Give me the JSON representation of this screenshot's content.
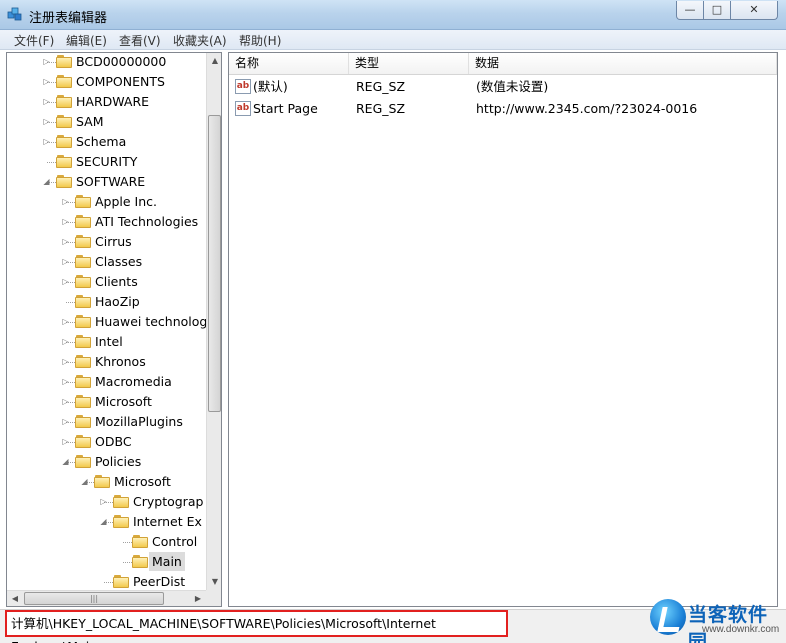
{
  "window": {
    "title": "注册表编辑器",
    "controls": {
      "minimize": "—",
      "maximize": "□",
      "close": "✕"
    }
  },
  "menu": [
    "文件(F)",
    "编辑(E)",
    "查看(V)",
    "收藏夹(A)",
    "帮助(H)"
  ],
  "tree": {
    "items": [
      {
        "label": "BCD00000000",
        "level": 0,
        "state": "collapsed"
      },
      {
        "label": "COMPONENTS",
        "level": 0,
        "state": "collapsed"
      },
      {
        "label": "HARDWARE",
        "level": 0,
        "state": "collapsed"
      },
      {
        "label": "SAM",
        "level": 0,
        "state": "collapsed"
      },
      {
        "label": "Schema",
        "level": 0,
        "state": "collapsed"
      },
      {
        "label": "SECURITY",
        "level": 0,
        "state": "none"
      },
      {
        "label": "SOFTWARE",
        "level": 0,
        "state": "expanded"
      },
      {
        "label": "Apple Inc.",
        "level": 1,
        "state": "collapsed"
      },
      {
        "label": "ATI Technologies",
        "level": 1,
        "state": "collapsed"
      },
      {
        "label": "Cirrus",
        "level": 1,
        "state": "collapsed"
      },
      {
        "label": "Classes",
        "level": 1,
        "state": "collapsed"
      },
      {
        "label": "Clients",
        "level": 1,
        "state": "collapsed"
      },
      {
        "label": "HaoZip",
        "level": 1,
        "state": "none"
      },
      {
        "label": "Huawei technolog",
        "level": 1,
        "state": "collapsed"
      },
      {
        "label": "Intel",
        "level": 1,
        "state": "collapsed"
      },
      {
        "label": "Khronos",
        "level": 1,
        "state": "collapsed"
      },
      {
        "label": "Macromedia",
        "level": 1,
        "state": "collapsed"
      },
      {
        "label": "Microsoft",
        "level": 1,
        "state": "collapsed"
      },
      {
        "label": "MozillaPlugins",
        "level": 1,
        "state": "collapsed"
      },
      {
        "label": "ODBC",
        "level": 1,
        "state": "collapsed"
      },
      {
        "label": "Policies",
        "level": 1,
        "state": "expanded"
      },
      {
        "label": "Microsoft",
        "level": 2,
        "state": "expanded"
      },
      {
        "label": "Cryptograp",
        "level": 3,
        "state": "collapsed"
      },
      {
        "label": "Internet Ex",
        "level": 3,
        "state": "expanded"
      },
      {
        "label": "Control",
        "level": 4,
        "state": "none"
      },
      {
        "label": "Main",
        "level": 4,
        "state": "none",
        "selected": true
      },
      {
        "label": "PeerDist",
        "level": 3,
        "state": "none"
      }
    ]
  },
  "values": {
    "columns": [
      "名称",
      "类型",
      "数据"
    ],
    "rows": [
      {
        "icon": "ab",
        "name": "(默认)",
        "type": "REG_SZ",
        "data": "(数值未设置)"
      },
      {
        "icon": "ab",
        "name": "Start Page",
        "type": "REG_SZ",
        "data": "http://www.2345.com/?23024-0016"
      }
    ]
  },
  "status": {
    "path": "计算机\\HKEY_LOCAL_MACHINE\\SOFTWARE\\Policies\\Microsoft\\Internet Explorer\\Main",
    "highlight_color": "#e2201f"
  },
  "watermark": {
    "text": "当客软件园",
    "url": "www.downkr.com"
  }
}
